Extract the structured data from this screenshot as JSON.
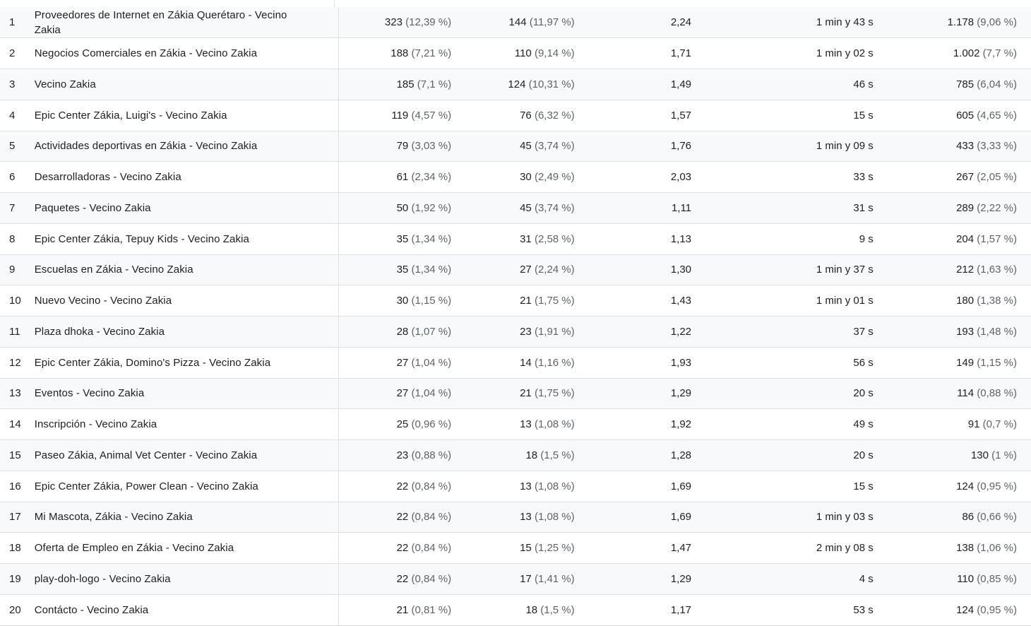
{
  "rows": [
    {
      "n": "1",
      "title": "Proveedores de Internet en Zákia Querétaro - Vecino Zakia",
      "views": "323",
      "views_pct": "(12,39 %)",
      "users": "144",
      "users_pct": "(11,97 %)",
      "per_user": "2,24",
      "time": "1 min y 43 s",
      "events": "1.178",
      "events_pct": "(9,06 %)"
    },
    {
      "n": "2",
      "title": "Negocios Comerciales en Zákia - Vecino Zakia",
      "views": "188",
      "views_pct": "(7,21 %)",
      "users": "110",
      "users_pct": "(9,14 %)",
      "per_user": "1,71",
      "time": "1 min y 02 s",
      "events": "1.002",
      "events_pct": "(7,7 %)"
    },
    {
      "n": "3",
      "title": "Vecino Zakia",
      "views": "185",
      "views_pct": "(7,1 %)",
      "users": "124",
      "users_pct": "(10,31 %)",
      "per_user": "1,49",
      "time": "46 s",
      "events": "785",
      "events_pct": "(6,04 %)"
    },
    {
      "n": "4",
      "title": "Epic Center Zákia, Luigi's - Vecino Zakia",
      "views": "119",
      "views_pct": "(4,57 %)",
      "users": "76",
      "users_pct": "(6,32 %)",
      "per_user": "1,57",
      "time": "15 s",
      "events": "605",
      "events_pct": "(4,65 %)"
    },
    {
      "n": "5",
      "title": "Actividades deportivas en Zákia - Vecino Zakia",
      "views": "79",
      "views_pct": "(3,03 %)",
      "users": "45",
      "users_pct": "(3,74 %)",
      "per_user": "1,76",
      "time": "1 min y 09 s",
      "events": "433",
      "events_pct": "(3,33 %)"
    },
    {
      "n": "6",
      "title": "Desarrolladoras - Vecino Zakia",
      "views": "61",
      "views_pct": "(2,34 %)",
      "users": "30",
      "users_pct": "(2,49 %)",
      "per_user": "2,03",
      "time": "33 s",
      "events": "267",
      "events_pct": "(2,05 %)"
    },
    {
      "n": "7",
      "title": "Paquetes - Vecino Zakia",
      "views": "50",
      "views_pct": "(1,92 %)",
      "users": "45",
      "users_pct": "(3,74 %)",
      "per_user": "1,11",
      "time": "31 s",
      "events": "289",
      "events_pct": "(2,22 %)"
    },
    {
      "n": "8",
      "title": "Epic Center Zákia, Tepuy Kids - Vecino Zakia",
      "views": "35",
      "views_pct": "(1,34 %)",
      "users": "31",
      "users_pct": "(2,58 %)",
      "per_user": "1,13",
      "time": "9 s",
      "events": "204",
      "events_pct": "(1,57 %)"
    },
    {
      "n": "9",
      "title": "Escuelas en Zákia - Vecino Zakia",
      "views": "35",
      "views_pct": "(1,34 %)",
      "users": "27",
      "users_pct": "(2,24 %)",
      "per_user": "1,30",
      "time": "1 min y 37 s",
      "events": "212",
      "events_pct": "(1,63 %)"
    },
    {
      "n": "10",
      "title": "Nuevo Vecino - Vecino Zakia",
      "views": "30",
      "views_pct": "(1,15 %)",
      "users": "21",
      "users_pct": "(1,75 %)",
      "per_user": "1,43",
      "time": "1 min y 01 s",
      "events": "180",
      "events_pct": "(1,38 %)"
    },
    {
      "n": "11",
      "title": "Plaza dhoka - Vecino Zakia",
      "views": "28",
      "views_pct": "(1,07 %)",
      "users": "23",
      "users_pct": "(1,91 %)",
      "per_user": "1,22",
      "time": "37 s",
      "events": "193",
      "events_pct": "(1,48 %)"
    },
    {
      "n": "12",
      "title": "Epic Center Zákia, Domino's Pizza - Vecino Zakia",
      "views": "27",
      "views_pct": "(1,04 %)",
      "users": "14",
      "users_pct": "(1,16 %)",
      "per_user": "1,93",
      "time": "56 s",
      "events": "149",
      "events_pct": "(1,15 %)"
    },
    {
      "n": "13",
      "title": "Eventos - Vecino Zakia",
      "views": "27",
      "views_pct": "(1,04 %)",
      "users": "21",
      "users_pct": "(1,75 %)",
      "per_user": "1,29",
      "time": "20 s",
      "events": "114",
      "events_pct": "(0,88 %)"
    },
    {
      "n": "14",
      "title": "Inscripción - Vecino Zakia",
      "views": "25",
      "views_pct": "(0,96 %)",
      "users": "13",
      "users_pct": "(1,08 %)",
      "per_user": "1,92",
      "time": "49 s",
      "events": "91",
      "events_pct": "(0,7 %)"
    },
    {
      "n": "15",
      "title": "Paseo Zákia, Animal Vet Center - Vecino Zakia",
      "views": "23",
      "views_pct": "(0,88 %)",
      "users": "18",
      "users_pct": "(1,5 %)",
      "per_user": "1,28",
      "time": "20 s",
      "events": "130",
      "events_pct": "(1 %)"
    },
    {
      "n": "16",
      "title": "Epic Center Zákia, Power Clean - Vecino Zakia",
      "views": "22",
      "views_pct": "(0,84 %)",
      "users": "13",
      "users_pct": "(1,08 %)",
      "per_user": "1,69",
      "time": "15 s",
      "events": "124",
      "events_pct": "(0,95 %)"
    },
    {
      "n": "17",
      "title": "Mi Mascota, Zákia - Vecino Zakia",
      "views": "22",
      "views_pct": "(0,84 %)",
      "users": "13",
      "users_pct": "(1,08 %)",
      "per_user": "1,69",
      "time": "1 min y 03 s",
      "events": "86",
      "events_pct": "(0,66 %)"
    },
    {
      "n": "18",
      "title": "Oferta de Empleo en Zákia - Vecino Zakia",
      "views": "22",
      "views_pct": "(0,84 %)",
      "users": "15",
      "users_pct": "(1,25 %)",
      "per_user": "1,47",
      "time": "2 min y 08 s",
      "events": "138",
      "events_pct": "(1,06 %)"
    },
    {
      "n": "19",
      "title": "play-doh-logo - Vecino Zakia",
      "views": "22",
      "views_pct": "(0,84 %)",
      "users": "17",
      "users_pct": "(1,41 %)",
      "per_user": "1,29",
      "time": "4 s",
      "events": "110",
      "events_pct": "(0,85 %)"
    },
    {
      "n": "20",
      "title": "Contácto - Vecino Zakia",
      "views": "21",
      "views_pct": "(0,81 %)",
      "users": "18",
      "users_pct": "(1,5 %)",
      "per_user": "1,17",
      "time": "53 s",
      "events": "124",
      "events_pct": "(0,95 %)"
    }
  ]
}
